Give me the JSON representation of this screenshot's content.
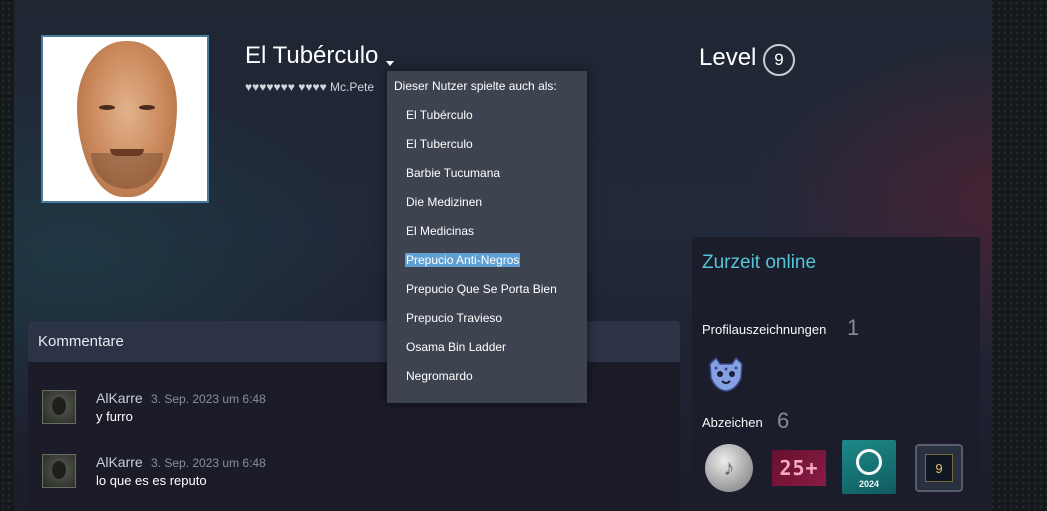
{
  "profile": {
    "persona_name": "El Tubérculo",
    "real_name": "♥♥♥♥♥♥♥ ♥♥♥♥ Mc.Pete",
    "level_label": "Level",
    "level": "9"
  },
  "name_history": {
    "title": "Dieser Nutzer spielte auch als:",
    "items": [
      "El Tubérculo",
      "El Tuberculo",
      "Barbie Tucumana",
      "Die Medizinen",
      "El Medicinas",
      "Prepucio Anti-Negros",
      "Prepucio Que Se Porta Bien",
      "Prepucio Travieso",
      "Osama Bin Ladder",
      "Negromardo"
    ],
    "highlighted_index": 5
  },
  "comments": {
    "title": "Kommentare",
    "items": [
      {
        "author": "AlKarre",
        "time": "3. Sep. 2023 um 6:48",
        "text": "y furro"
      },
      {
        "author": "AlKarre",
        "time": "3. Sep. 2023 um 6:48",
        "text": "lo que es es reputo"
      }
    ]
  },
  "sidebar": {
    "online_status": "Zurzeit online",
    "awards_label": "Profilauszeichnungen",
    "awards_count": "1",
    "badges_label": "Abzeichen",
    "badges_count": "6",
    "badges": [
      {
        "icon": "silver-lyre-badge-icon",
        "text": ""
      },
      {
        "icon": "years-of-service-badge-icon",
        "text": "25+"
      },
      {
        "icon": "steam-replay-badge-icon",
        "text": "2024"
      },
      {
        "icon": "level-badge-icon",
        "text": "9"
      }
    ]
  },
  "colors": {
    "online_accent": "#57cbde",
    "highlight": "#5f9fd1",
    "dropdown_bg": "#3d4450"
  }
}
